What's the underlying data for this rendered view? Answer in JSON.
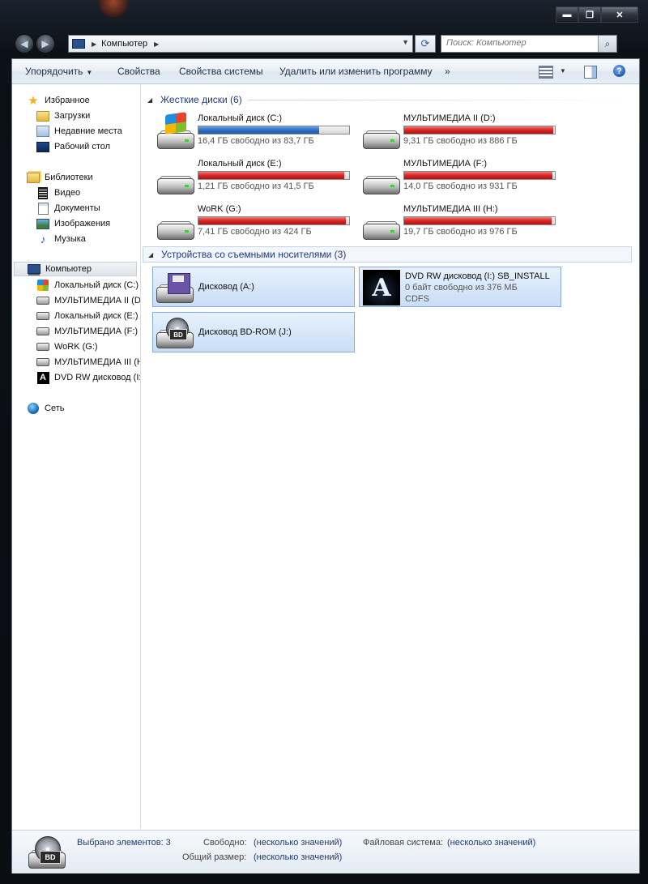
{
  "window": {
    "caption_buttons": {
      "minimize": "▬",
      "maximize": "❐",
      "close": "✕"
    }
  },
  "address_bar": {
    "crumb": "Компьютер",
    "search_placeholder": "Поиск: Компьютер"
  },
  "toolbar": {
    "organize": "Упорядочить",
    "properties": "Свойства",
    "system_properties": "Свойства системы",
    "uninstall": "Удалить или изменить программу",
    "more": "»"
  },
  "nav": {
    "favorites": "Избранное",
    "downloads": "Загрузки",
    "recent": "Недавние места",
    "desktop": "Рабочий стол",
    "libraries": "Библиотеки",
    "video": "Видео",
    "documents": "Документы",
    "pictures": "Изображения",
    "music": "Музыка",
    "computer": "Компьютер",
    "drives": [
      "Локальный диск (C:)",
      "МУЛЬТИМЕДИА II (D:)",
      "Локальный диск (E:)",
      "МУЛЬТИМЕДИА (F:)",
      "WoRK (G:)",
      "МУЛЬТИМЕДИА III (H:)",
      "DVD RW дисковод (I:)"
    ],
    "network": "Сеть"
  },
  "groups": {
    "hard_drives": "Жесткие диски (6)",
    "removable": "Устройства со съемными носителями (3)"
  },
  "hard_drives": [
    {
      "name": "Локальный диск (C:)",
      "free": "16,4 ГБ свободно из 83,7 ГБ",
      "used_fraction": 0.8
    },
    {
      "name": "МУЛЬТИМЕДИА II (D:)",
      "free": "9,31 ГБ свободно из 886 ГБ",
      "used_fraction": 0.99
    },
    {
      "name": "Локальный диск (E:)",
      "free": "1,21 ГБ свободно из 41,5 ГБ",
      "used_fraction": 0.97
    },
    {
      "name": "МУЛЬТИМЕДИА (F:)",
      "free": "14,0 ГБ свободно из 931 ГБ",
      "used_fraction": 0.985
    },
    {
      "name": "WoRK (G:)",
      "free": "7,41 ГБ свободно из 424 ГБ",
      "used_fraction": 0.98
    },
    {
      "name": "МУЛЬТИМЕДИА III (H:)",
      "free": "19,7 ГБ свободно из 976 ГБ",
      "used_fraction": 0.98
    }
  ],
  "removable": {
    "floppy": "Дисковод (A:)",
    "dvd_name": "DVD RW дисковод (I:) SB_INSTALL",
    "dvd_free": "0 байт свободно из 376 МБ",
    "dvd_fs": "CDFS",
    "bd": "Дисковод BD-ROM (J:)",
    "bd_badge": "BD"
  },
  "details": {
    "selected": "Выбрано элементов: 3",
    "free_label": "Свободно:",
    "free_value": "(несколько значений)",
    "fs_label": "Файловая система:",
    "fs_value": "(несколько значений)",
    "total_label": "Общий размер:",
    "total_value": "(несколько значений)",
    "icon_badge": "BD"
  },
  "colors": {
    "bar_ok": "#2e6fc4",
    "bar_full": "#d62424",
    "group_title": "#1e3a8a",
    "selection": "#c9def6"
  }
}
